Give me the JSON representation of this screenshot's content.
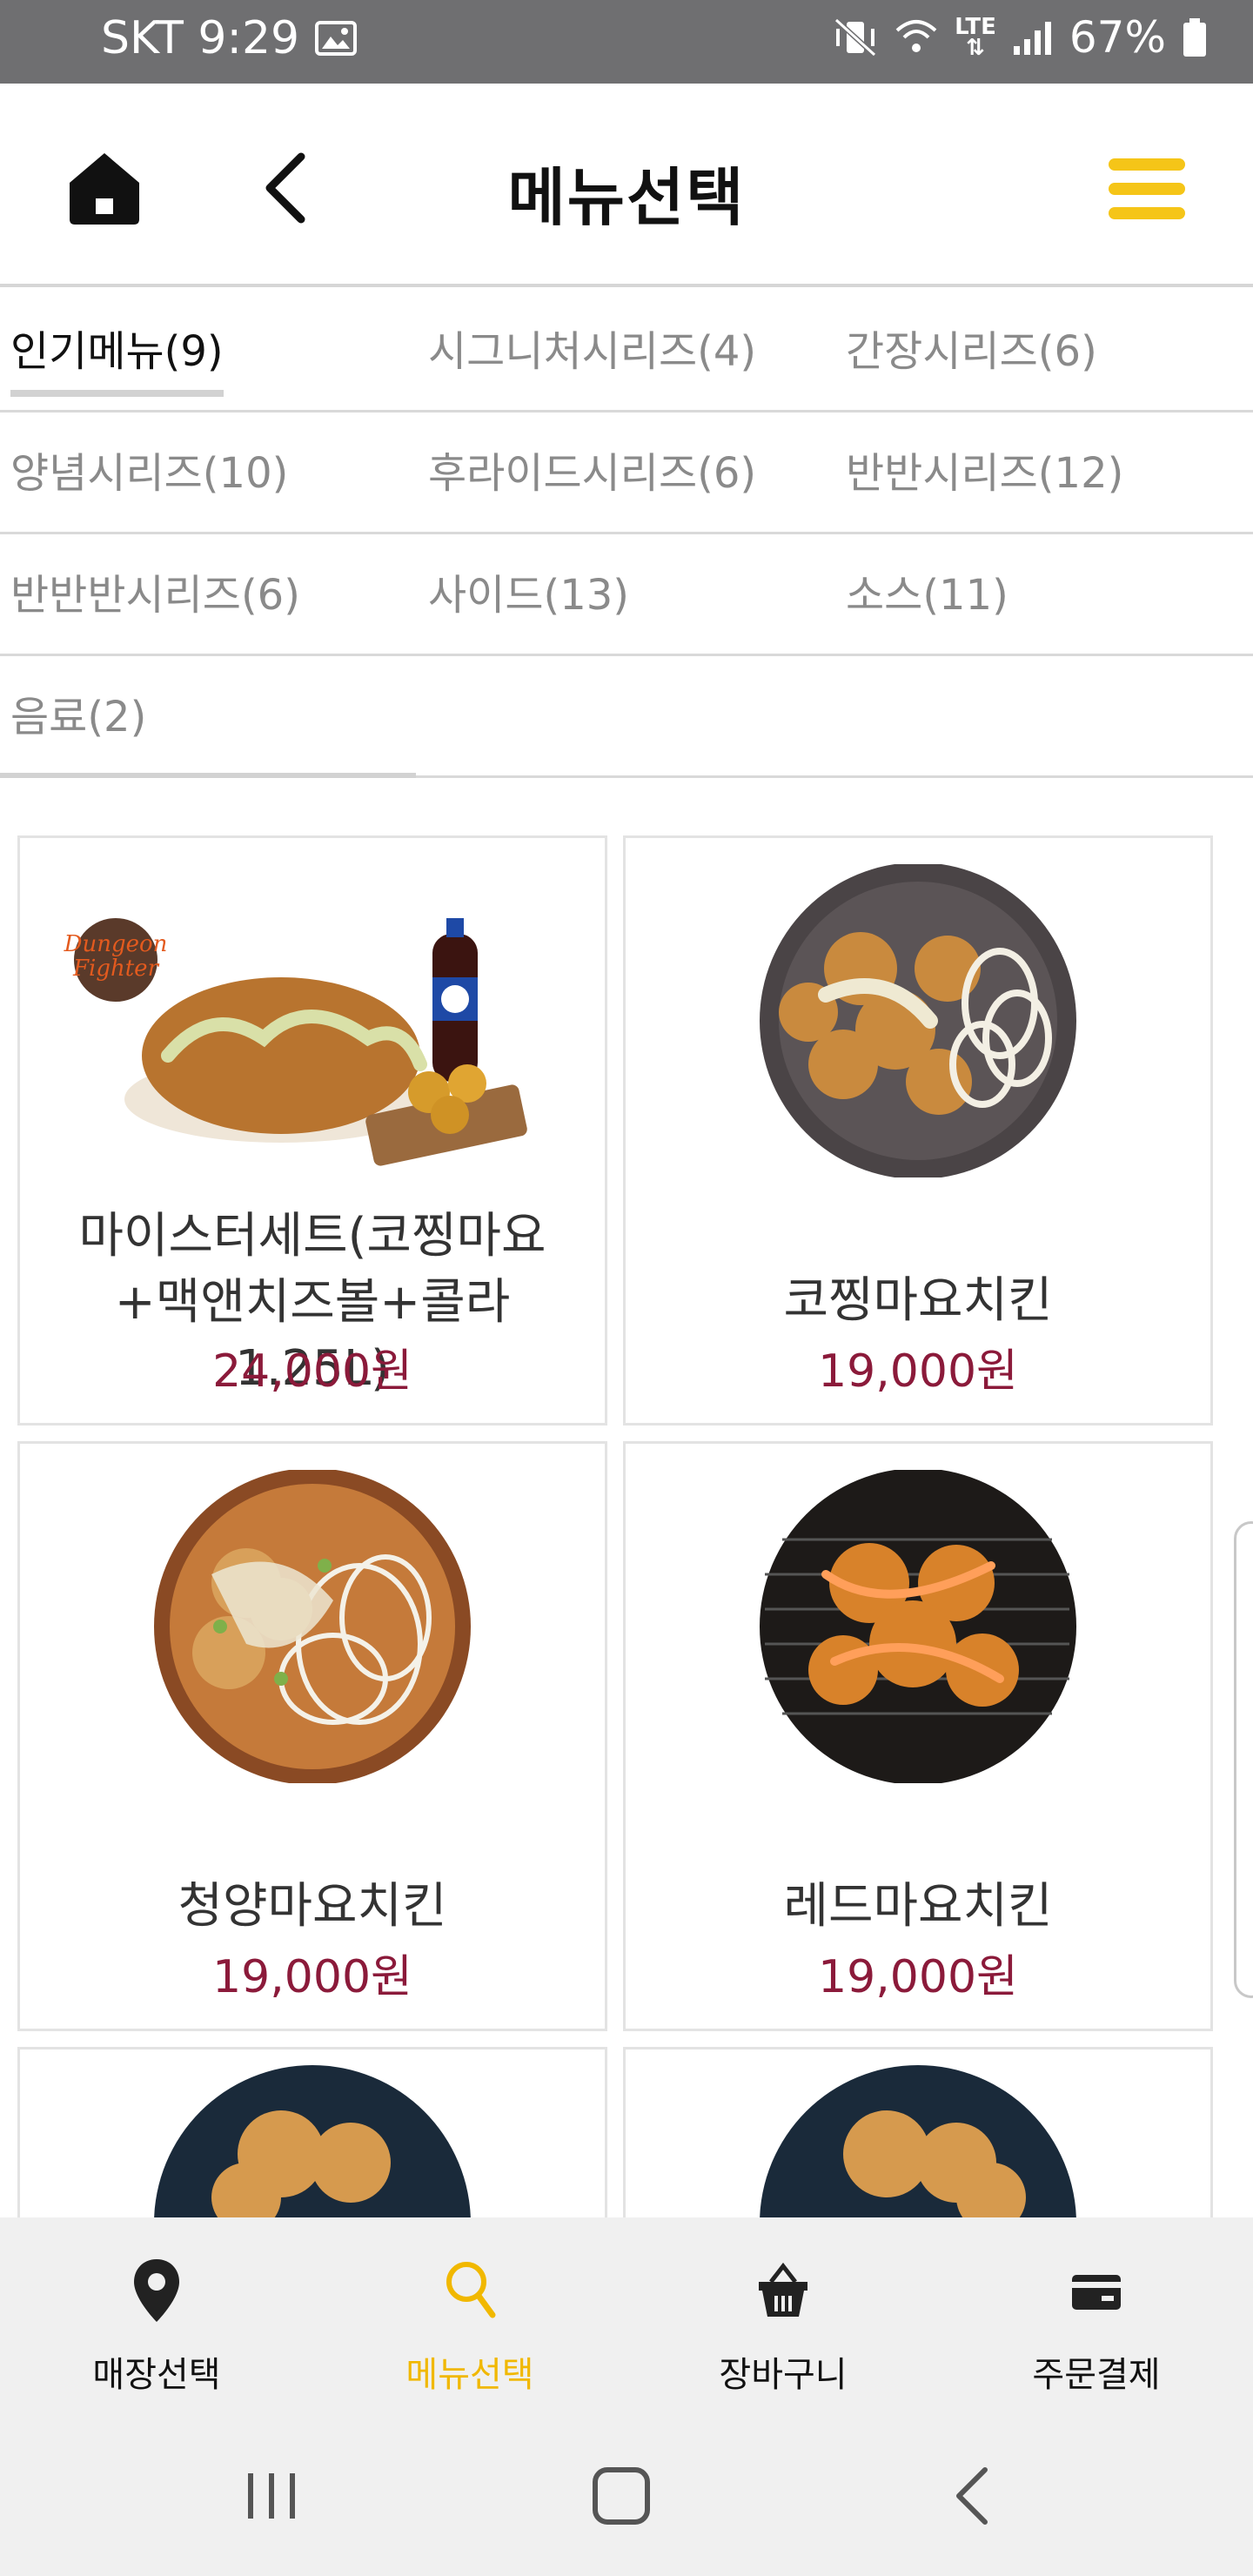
{
  "status_bar": {
    "carrier_time": "SKT 9:29",
    "battery": "67%",
    "network": "LTE"
  },
  "header": {
    "title": "메뉴선택",
    "accent_color": "#f5c518"
  },
  "categories": [
    [
      "인기메뉴(9)",
      "시그니처시리즈(4)",
      "간장시리즈(6)"
    ],
    [
      "양념시리즈(10)",
      "후라이드시리즈(6)",
      "반반시리즈(12)"
    ],
    [
      "반반반시리즈(6)",
      "사이드(13)",
      "소스(11)"
    ],
    [
      "음료(2)"
    ]
  ],
  "active_category": "인기메뉴(9)",
  "products": [
    {
      "name": "마이스터세트(코찡마요+맥앤치즈볼+콜라1.25L)",
      "price": "24,000원"
    },
    {
      "name": "코찡마요치킨",
      "price": "19,000원"
    },
    {
      "name": "청양마요치킨",
      "price": "19,000원"
    },
    {
      "name": "레드마요치킨",
      "price": "19,000원"
    }
  ],
  "bottom_nav": [
    {
      "label": "매장선택",
      "icon": "location-pin-icon"
    },
    {
      "label": "메뉴선택",
      "icon": "search-icon",
      "active": true
    },
    {
      "label": "장바구니",
      "icon": "basket-icon"
    },
    {
      "label": "주문결제",
      "icon": "card-icon"
    }
  ],
  "colors": {
    "price": "#8b1a3a",
    "active_nav": "#f1b800",
    "status_bar": "#6f6f71"
  }
}
